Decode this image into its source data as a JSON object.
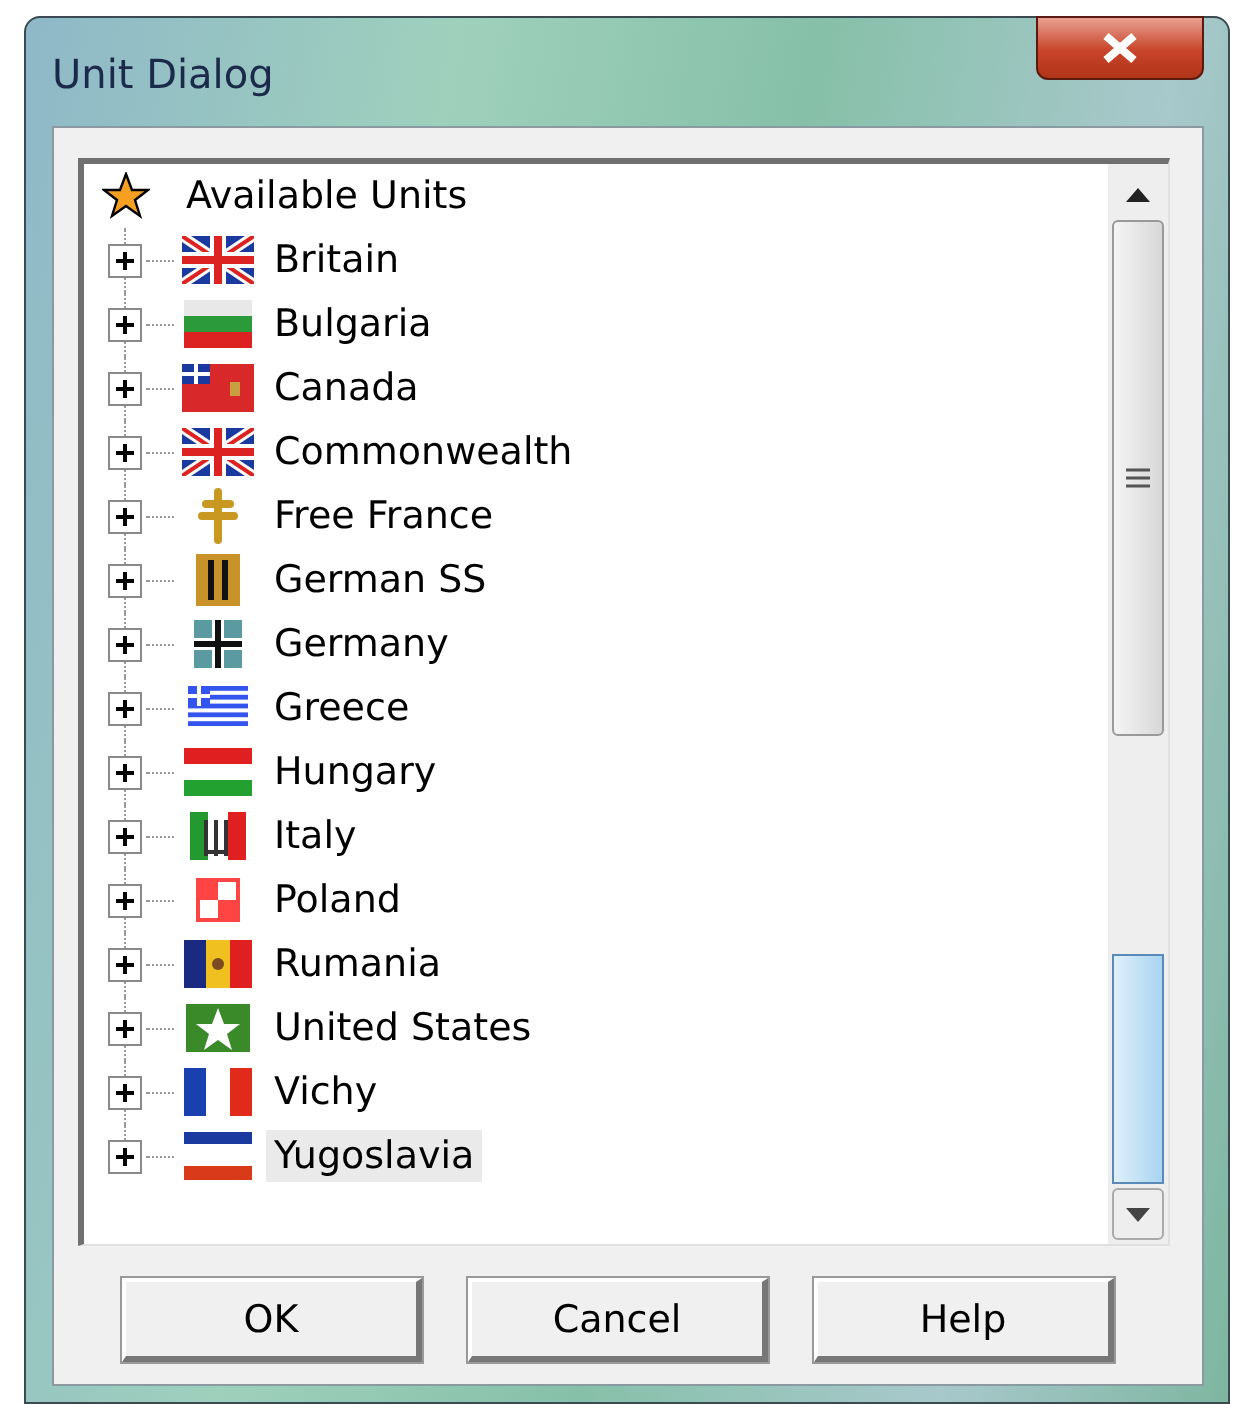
{
  "window": {
    "title": "Unit Dialog"
  },
  "tree": {
    "root": {
      "label": "Available Units",
      "children": [
        {
          "label": "Britain",
          "expanded": false,
          "selected": false
        },
        {
          "label": "Bulgaria",
          "expanded": false,
          "selected": false
        },
        {
          "label": "Canada",
          "expanded": false,
          "selected": false
        },
        {
          "label": "Commonwealth",
          "expanded": false,
          "selected": false
        },
        {
          "label": "Free France",
          "expanded": false,
          "selected": false
        },
        {
          "label": "German SS",
          "expanded": false,
          "selected": false
        },
        {
          "label": "Germany",
          "expanded": false,
          "selected": false
        },
        {
          "label": "Greece",
          "expanded": false,
          "selected": false
        },
        {
          "label": "Hungary",
          "expanded": false,
          "selected": false
        },
        {
          "label": "Italy",
          "expanded": false,
          "selected": false
        },
        {
          "label": "Poland",
          "expanded": false,
          "selected": false
        },
        {
          "label": "Rumania",
          "expanded": false,
          "selected": false
        },
        {
          "label": "United States",
          "expanded": false,
          "selected": false
        },
        {
          "label": "Vichy",
          "expanded": false,
          "selected": false
        },
        {
          "label": "Yugoslavia",
          "expanded": false,
          "selected": true
        }
      ]
    }
  },
  "buttons": [
    "OK",
    "Cancel",
    "Help"
  ]
}
